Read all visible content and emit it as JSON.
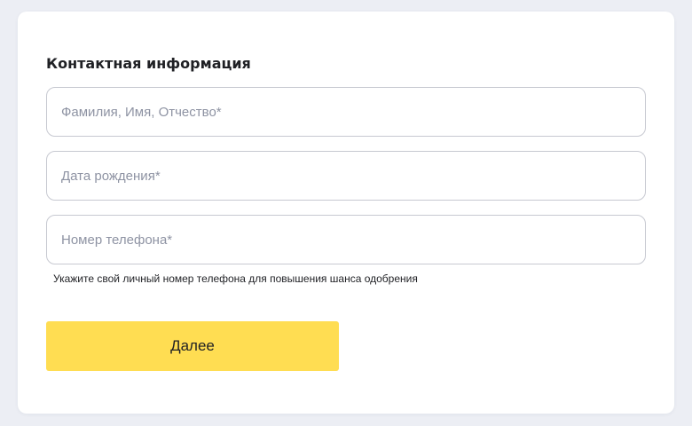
{
  "form": {
    "title": "Контактная информация",
    "fields": [
      {
        "placeholder": "Фамилия, Имя, Отчество*",
        "value": ""
      },
      {
        "placeholder": "Дата рождения*",
        "value": ""
      },
      {
        "placeholder": "Номер телефона*",
        "value": ""
      }
    ],
    "phone_hint": "Укажите свой личный номер телефона для повышения шанса одобрения",
    "submit_label": "Далее"
  },
  "colors": {
    "page_background": "#eceef4",
    "card_background": "#ffffff",
    "field_border": "#c7c9d1",
    "placeholder_text": "#8e93a3",
    "button_background": "#ffdd52",
    "text": "#1f2024"
  }
}
